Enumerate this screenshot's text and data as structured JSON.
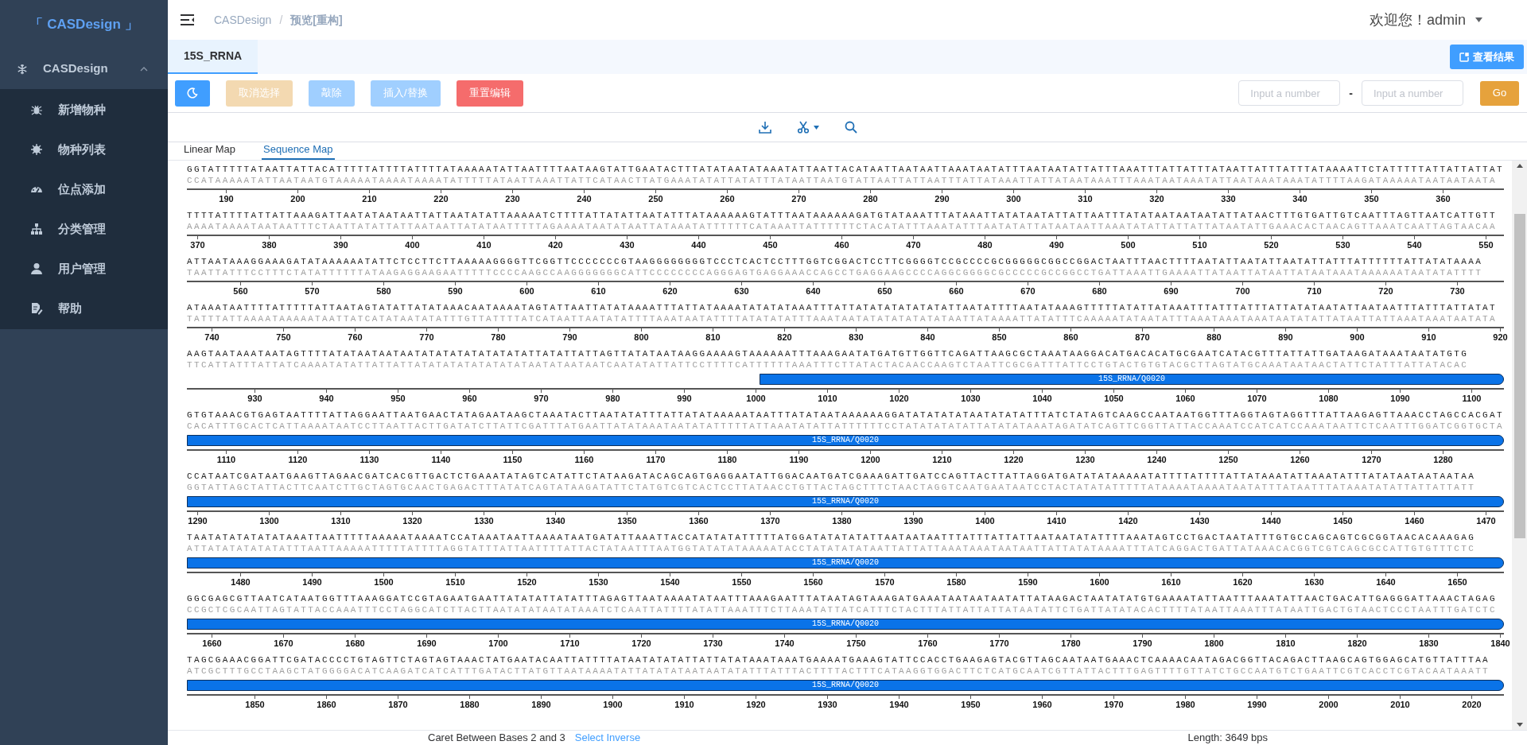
{
  "sidebar": {
    "logo": "「 CASDesign 」",
    "group": {
      "label": "CASDesign",
      "expanded": true
    },
    "items": [
      {
        "label": "新增物种",
        "kind": "bug"
      },
      {
        "label": "物种列表",
        "kind": "virus"
      },
      {
        "label": "位点添加",
        "kind": "gauge"
      },
      {
        "label": "分类管理",
        "kind": "tree"
      },
      {
        "label": "用户管理",
        "kind": "user"
      },
      {
        "label": "帮助",
        "kind": "doc"
      }
    ]
  },
  "header": {
    "breadcrumb": [
      "CASDesign",
      "预览[重构]"
    ],
    "separator": "/",
    "user": "欢迎您！admin"
  },
  "tabs": [
    {
      "label": "15S_RRNA",
      "selected": true
    }
  ],
  "result_button": "查看结果",
  "toolbar": {
    "buttons": [
      {
        "kind": "theme",
        "disabled": false
      },
      {
        "label": "取消选择",
        "kind": "warning",
        "disabled": true
      },
      {
        "label": "敲除",
        "kind": "primary",
        "disabled": true
      },
      {
        "label": "插入/替换",
        "kind": "primary",
        "disabled": true
      },
      {
        "label": "重置编辑",
        "kind": "danger",
        "disabled": false
      }
    ],
    "range": {
      "from": {
        "placeholder": "Input a number"
      },
      "separator": "-",
      "to": {
        "placeholder": "Input a number"
      },
      "go": "Go"
    }
  },
  "map_tabs": [
    {
      "label": "Linear Map",
      "selected": false
    },
    {
      "label": "Sequence Map",
      "selected": true
    }
  ],
  "rows": [
    {
      "top": "GGTATTTTTATAATTATTACATTTTTATTTTATTTTATAAAAATATTAATTTTAATAAGTATTGAATACTTTATATAATATAAATATTAATTACATAATTAATAATTAAATAATATTTAATAATATTATTTAAATTTATTATTTATAATTATTTATTTATAAAATTCTATTTTTATTATTATTAT",
      "bottom": "CCATAAAAATATTAATAATGTAAAAATAAAATAAAATATTTTTATAATTAAATTATTCATAACTTATGAAATATATTATATTTATAATTAATGTATTAATTATTAATTTATTATAAATTATTATAATAAATTTAAATAATAAATATTAATAAATAAATATTTTAAGATAAAAATAATAATAATA",
      "ticks": [
        "190",
        "200",
        "210",
        "220",
        "230",
        "240",
        "250",
        "260",
        "270",
        "280",
        "290",
        "300",
        "310",
        "320",
        "330",
        "340",
        "350",
        "360"
      ]
    },
    {
      "top": "TTTTATTTTATTATTAAAGATTAATATAATAATTATTAATATATTAAAAATCTTTTATTATATTAATATTTATAAAAAAGTATTTAATAAAAAAGATGTATAAATTTATAAATTATATAATATTATTAATTTATATAATAATAATATTATAACTTTGTGATTGTCAATTTAGTTAATCATTGTT",
      "bottom": "AAAATAAAATAATAATTTCTAATTATATTATTAATAATTATATAATTTTTAGAAAATAATATAATTATAAATATTTTTTCATAAATTATTTTTTCTACATATTTAAATATTTAATATATTATAATAATTAAATATATTATTATTATAATATTGAAACACTAACAGTTAAATCAATTAGTAACAA",
      "ticks": [
        "370",
        "380",
        "390",
        "400",
        "410",
        "420",
        "430",
        "440",
        "450",
        "460",
        "470",
        "480",
        "490",
        "500",
        "510",
        "520",
        "530",
        "540",
        "550"
      ]
    },
    {
      "top": "ATTAATAAAGGAAAGATATAAAAAATATTCTCCTTCTTAAAAAGGGGTTCGGTTCCCCCCCGTAAGGGGGGGGTCCCTCACTCCTTTGGTCGGACTCCTTCGGGGTCCGCCCCGCGGGGGCGGCCGGACTAATTTAACTTTTAATATTAATATTAATATTATTTATTTTTTATTATATAAAA",
      "bottom": "TAATTATTTCCTTTCTATATTTTTTATAAGAGGAAGAATTTTTCCCCAAGCCAAGGGGGGGCATTCCCCCCCCAGGGAGTGAGGAAACCAGCCTGAGGAAGCCCCAGGCGGGGCGCCCCCGCCGGCCTGATTAAATTGAAAATTATAATTATAATTATAATAAATAAAAAATAATATATTTT",
      "ticks": [
        "560",
        "570",
        "580",
        "590",
        "600",
        "610",
        "620",
        "630",
        "640",
        "650",
        "660",
        "670",
        "680",
        "690",
        "700",
        "710",
        "720",
        "730"
      ]
    },
    {
      "top": "ATAAATAATTTTATTTTTATTAATAGTATATTATATAAACAATAAAATAGTATTAATTATATAAAATTTATTATAAAATATATATAAATTTATTATATATATATATATTAATATTTTAATATAAAGTTTTTATATTATAAATTTATTTATTTATTATATAATATTAATAATTTATTTATTATAT",
      "bottom": "TATTTATTAAAATAAAAATAATTATCATATAATATATTTGTTATTTTATCATAATTAATATATTTTAAATAATATTTTATATATATTTAAATAATATATATATATATAATTATAAAATTATATTTCAAAAATATAATATTTAAATAAATAAATAATATATTATAATTATTAAATAAATAATATA",
      "ticks": [
        "740",
        "750",
        "760",
        "770",
        "780",
        "790",
        "800",
        "810",
        "820",
        "830",
        "840",
        "850",
        "860",
        "870",
        "880",
        "890",
        "900",
        "910",
        "920"
      ]
    },
    {
      "top": "AAGTAATAAATAATAGTTTTATATAATAATAATATATATATATATATATTATATTATTAGTTATATAATAAGGAAAAGTAAAAAATTTAAAGAATATGATGTTGGTTCAGATTAAGCGCTAAATAAGGACATGACACATGCGAATCATACGTTTATTATTGATAAGATAAATAATATGTG",
      "bottom": "TTCATTATTTATTATCAAAATATATTATTATTATATATATATATATATAATATAATAATCAATATATTATTCCTTTTCATTTTTTAAATTTCTTATACTACAACCAAGTCTAATTCGCGATTTATTCCTGTACTGTGTACGCTTAGTATGCAAATAATAACTATTCTATTTATTATACAC",
      "feature": {
        "label": "15S_RRNA/Q0020",
        "kind": "begins"
      },
      "ticks": [
        "930",
        "940",
        "950",
        "960",
        "970",
        "980",
        "990",
        "1000",
        "1010",
        "1020",
        "1030",
        "1040",
        "1050",
        "1060",
        "1070",
        "1080",
        "1090",
        "1100"
      ]
    },
    {
      "top": "GTGTAAACGTGAGTAATTTTATTAGGAATTAATGAACTATAGAATAAGCTAAATACTTAATATATTTATTATATAAAAATAATTTATATAATAAAAAAGGATATATATATAATATATATTTATCTATAGTCAAGCCAATAATGGTTTAGGTAGTAGGTTTATTAAGAGTTAAACCTAGCCACGAT",
      "bottom": "CACATTTGCACTCATTAAAATAATCCTTAATTACTTGATATCTTATTCGATTTATGAATTATATAAATAATATATTTTTATTAAATATATTATTTTTTCCTATATATATATTATATATAAATAGATATCAGTTCGGTTATTACCAAATCCATCATCCAAATAATTCTCAATTTGGATCGGTGCTA",
      "feature": {
        "label": "15S_RRNA/Q0020",
        "kind": "continues"
      },
      "ticks": [
        "1110",
        "1120",
        "1130",
        "1140",
        "1150",
        "1160",
        "1170",
        "1180",
        "1190",
        "1200",
        "1210",
        "1220",
        "1230",
        "1240",
        "1250",
        "1260",
        "1270",
        "1280"
      ]
    },
    {
      "top": "CCATAATCGATAATGAAGTTAGAACGATCACGTTGACTCTGAAATATAGTCATATTCTATAAGATACAGCAGTGAGGAATATTGGACAATGATCGAAAGATTGATCCAGTTACTTATTAGGATGATATATAAAAATATTTTATTTTATTATAAATATTAAATATTTATATAATAATAATAA",
      "bottom": "GGTATTAGCTATTACTTCAATCTTGCTAGTGCAACTGAGACTTTATATCAGTATAAGATATTCTATGTCGTCACTCCTTATAACCTGTTACTAGCTTTCTAACTAGGTCAATGAATAATCCTACTATATATTTTTATAAAATAAAATAATATTTATAATTTATAAATATATTATTATTATT",
      "feature": {
        "label": "15S_RRNA/Q0020",
        "kind": "continues"
      },
      "ticks": [
        "1290",
        "1300",
        "1310",
        "1320",
        "1330",
        "1340",
        "1350",
        "1360",
        "1370",
        "1380",
        "1390",
        "1400",
        "1410",
        "1420",
        "1430",
        "1440",
        "1450",
        "1460",
        "1470"
      ]
    },
    {
      "top": "TAATATATATATATAAATTAATTTTTAAAAATAAAATCCATAAATAATTAAAATAATGATATTAAATTACCATATATATTTTTATGGATATATATATTAATAATAATTTATTTATTATTAATAATATATTTTAAATAGTCCTGACTAATATTTGTGCCAGCAGTCGCGGTAACACAAAGAG",
      "bottom": "ATTATATATATATATTTAATTAAAAATTTTTATTTTAGGTATTTATTAATTTTATTACTATAATTTAATGGTATATATAAAAATACCTATATATATAATTATTATTAAATAAATAATAATTATTATATAAAATTTATCAGGACTGATTATAAACACGGTCGTCAGCGCCATTGTGTTTCTC",
      "feature": {
        "label": "15S_RRNA/Q0020",
        "kind": "continues"
      },
      "ticks": [
        "1480",
        "1490",
        "1500",
        "1510",
        "1520",
        "1530",
        "1540",
        "1550",
        "1560",
        "1570",
        "1580",
        "1590",
        "1600",
        "1610",
        "1620",
        "1630",
        "1640",
        "1650"
      ]
    },
    {
      "top": "GGCGAGCGTTAATCATAATGGTTTAAAGGATCCGTAGAATGAATTATATATTATATTTAGAGTTAATAAAATATAATTTAAAGAATTTATAATAGTAAAGATGAAATAATAATAATATTATAAGACTAATATATGTGAAAATATTAATTTAAATATTAACTGACATTGAGGGATTAAACTAGAG",
      "bottom": "CCGCTCGCAATTAGTATTACCAAATTTCCTAGGCATCTTACTTAATATATAATATAAATCTCAATTATTTTATATTAAATTTCTTAAATATTATCATTTCTACTTTATTATTATTATAATATTCTGATTATATACACTTTTATAATTAAATTTATAATTGACTGTAACTCCCTAATTTGATCTC",
      "feature": {
        "label": "15S_RRNA/Q0020",
        "kind": "continues"
      },
      "ticks": [
        "1660",
        "1670",
        "1680",
        "1690",
        "1700",
        "1710",
        "1720",
        "1730",
        "1740",
        "1750",
        "1760",
        "1770",
        "1780",
        "1790",
        "1800",
        "1810",
        "1820",
        "1830",
        "1840"
      ]
    },
    {
      "top": "TAGCGAAACGGATTCGATACCCCTGTAGTTCTAGTAGTAAACTATGAATACAATTATTTTATAATATATATTATTATATAAATAAATGAAAATGAAAGTATTCCACCTGAAGAGTACGTTAGCAATAATGAAACTCAAAACAATAGACGGTTACAGACTTAAGCAGTGGAGCATGTTATTTAA",
      "bottom": "ATCGCTTTGCCTAAGCTATGGGGACATCAAGATCATCATTTGATACTTATGTTAATAAAATATTATATATAATAATATATTTATTTACTTTTACTTTCATAAGGTGGACTTCTCATGCAATCGTTATTACTTTGAGTTTTGTTATCTGCCAATGTCTGAATTCGTCACCTCGTACAATAAATT",
      "feature": {
        "label": "15S_RRNA/Q0020",
        "kind": "continues"
      },
      "ticks": [
        "1850",
        "1860",
        "1870",
        "1880",
        "1890",
        "1900",
        "1910",
        "1920",
        "1930",
        "1940",
        "1950",
        "1960",
        "1970",
        "1980",
        "1990",
        "2000",
        "2010",
        "2020"
      ]
    }
  ],
  "status_bar": {
    "caret": "Caret Between Bases 2 and 3",
    "select_inverse": "Select Inverse",
    "length": "Length: 3649 bps"
  }
}
